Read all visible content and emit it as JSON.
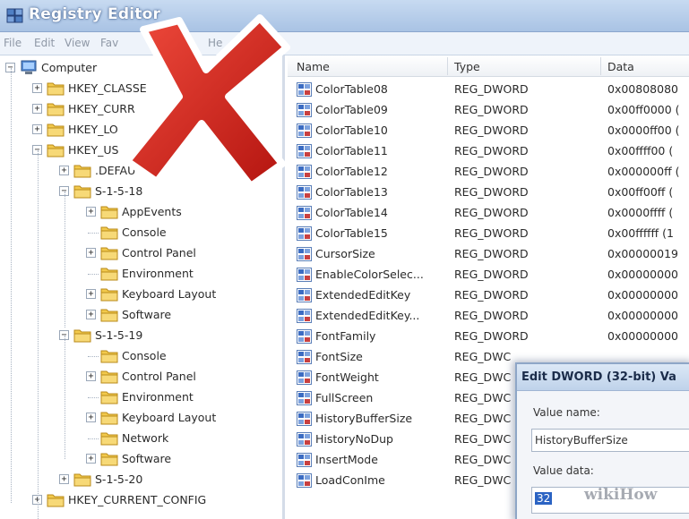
{
  "window": {
    "title": "Registry Editor"
  },
  "menu": [
    "File",
    "Edit",
    "View",
    "Fav",
    "He"
  ],
  "tree": [
    {
      "label": "Computer",
      "level": 0,
      "expander": "-",
      "icon": "computer-icon"
    },
    {
      "label": "HKEY_CLASSE",
      "level": 1,
      "expander": "+",
      "icon": "folder-icon"
    },
    {
      "label": "HKEY_CURR",
      "level": 1,
      "expander": "+",
      "icon": "folder-icon"
    },
    {
      "label": "HKEY_LO",
      "level": 1,
      "expander": "+",
      "icon": "folder-icon"
    },
    {
      "label": "HKEY_US",
      "level": 1,
      "expander": "-",
      "icon": "folder-icon"
    },
    {
      "label": ".DEFAU",
      "level": 2,
      "expander": "+",
      "icon": "folder-icon"
    },
    {
      "label": "S-1-5-18",
      "level": 2,
      "expander": "-",
      "icon": "folder-icon"
    },
    {
      "label": "AppEvents",
      "level": 3,
      "expander": "+",
      "icon": "folder-icon"
    },
    {
      "label": "Console",
      "level": 3,
      "expander": "",
      "icon": "folder-icon"
    },
    {
      "label": "Control Panel",
      "level": 3,
      "expander": "+",
      "icon": "folder-icon"
    },
    {
      "label": "Environment",
      "level": 3,
      "expander": "",
      "icon": "folder-icon"
    },
    {
      "label": "Keyboard Layout",
      "level": 3,
      "expander": "+",
      "icon": "folder-icon"
    },
    {
      "label": "Software",
      "level": 3,
      "expander": "+",
      "icon": "folder-icon"
    },
    {
      "label": "S-1-5-19",
      "level": 2,
      "expander": "-",
      "icon": "folder-icon"
    },
    {
      "label": "Console",
      "level": 3,
      "expander": "",
      "icon": "folder-icon"
    },
    {
      "label": "Control Panel",
      "level": 3,
      "expander": "+",
      "icon": "folder-icon"
    },
    {
      "label": "Environment",
      "level": 3,
      "expander": "",
      "icon": "folder-icon"
    },
    {
      "label": "Keyboard Layout",
      "level": 3,
      "expander": "+",
      "icon": "folder-icon"
    },
    {
      "label": "Network",
      "level": 3,
      "expander": "",
      "icon": "folder-icon"
    },
    {
      "label": "Software",
      "level": 3,
      "expander": "+",
      "icon": "folder-icon"
    },
    {
      "label": "S-1-5-20",
      "level": 2,
      "expander": "+",
      "icon": "folder-icon"
    },
    {
      "label": "HKEY_CURRENT_CONFIG",
      "level": 1,
      "expander": "+",
      "icon": "folder-icon"
    }
  ],
  "list": {
    "columns": [
      "Name",
      "Type",
      "Data"
    ],
    "rows": [
      {
        "name": "ColorTable08",
        "type": "REG_DWORD",
        "data": "0x00808080"
      },
      {
        "name": "ColorTable09",
        "type": "REG_DWORD",
        "data": "0x00ff0000 ("
      },
      {
        "name": "ColorTable10",
        "type": "REG_DWORD",
        "data": "0x0000ff00 ("
      },
      {
        "name": "ColorTable11",
        "type": "REG_DWORD",
        "data": "0x00ffff00 ("
      },
      {
        "name": "ColorTable12",
        "type": "REG_DWORD",
        "data": "0x000000ff ("
      },
      {
        "name": "ColorTable13",
        "type": "REG_DWORD",
        "data": "0x00ff00ff ("
      },
      {
        "name": "ColorTable14",
        "type": "REG_DWORD",
        "data": "0x0000ffff ("
      },
      {
        "name": "ColorTable15",
        "type": "REG_DWORD",
        "data": "0x00ffffff (1"
      },
      {
        "name": "CursorSize",
        "type": "REG_DWORD",
        "data": "0x00000019"
      },
      {
        "name": "EnableColorSelec...",
        "type": "REG_DWORD",
        "data": "0x00000000"
      },
      {
        "name": "ExtendedEditKey",
        "type": "REG_DWORD",
        "data": "0x00000000"
      },
      {
        "name": "ExtendedEditKey...",
        "type": "REG_DWORD",
        "data": "0x00000000"
      },
      {
        "name": "FontFamily",
        "type": "REG_DWORD",
        "data": "0x00000000"
      },
      {
        "name": "FontSize",
        "type": "REG_DWC",
        "data": ""
      },
      {
        "name": "FontWeight",
        "type": "REG_DWC",
        "data": ""
      },
      {
        "name": "FullScreen",
        "type": "REG_DWC",
        "data": ""
      },
      {
        "name": "HistoryBufferSize",
        "type": "REG_DWC",
        "data": ""
      },
      {
        "name": "HistoryNoDup",
        "type": "REG_DWC",
        "data": ""
      },
      {
        "name": "InsertMode",
        "type": "REG_DWC",
        "data": ""
      },
      {
        "name": "LoadConIme",
        "type": "REG_DWC",
        "data": ""
      }
    ]
  },
  "dialog": {
    "title": "Edit DWORD (32-bit) Va",
    "value_name_label": "Value name:",
    "value_name": "HistoryBufferSize",
    "value_data_label": "Value data:",
    "value_data": "32"
  },
  "watermark": "wikiHow",
  "colors": {
    "x_red": "#d8231f",
    "selection": "#2b63c3"
  }
}
